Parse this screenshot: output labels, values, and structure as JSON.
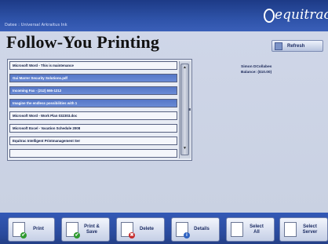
{
  "window": {
    "breadcrumb": "Datee : Universal Arkraitus Ink",
    "brand": "equitrac"
  },
  "page_title": "Follow-You Printing",
  "refresh": {
    "label": "Refresh",
    "icon": "refresh-icon"
  },
  "jobs": [
    {
      "name": "Microsoft Word - This is maintenance",
      "selected": false
    },
    {
      "name": "Gui Marrer Security Solutions.pdf",
      "selected": true
    },
    {
      "name": "Incoming Fax - (212) 555-1212",
      "selected": true
    },
    {
      "name": "Imagine the endless possibilities with 1",
      "selected": true
    },
    {
      "name": "Microsoft Word - Work Plan 032303.doc",
      "selected": false
    },
    {
      "name": "Microsoft Excel - Vacation Schedule 2008",
      "selected": false
    },
    {
      "name": "Equitrac Intelligent Printmanagement Ser",
      "selected": false
    },
    {
      "name": "",
      "selected": false
    }
  ],
  "user": {
    "line1": "Simon DCollabes",
    "line2": "Balance: ($10.00)"
  },
  "toolbar": {
    "buttons": [
      {
        "label_1": "Print",
        "label_2": "",
        "icon": "print-icon",
        "badge": "✔",
        "badge_color": "#2f9a2f"
      },
      {
        "label_1": "Print &",
        "label_2": "Save",
        "icon": "print-save-icon",
        "badge": "✔",
        "badge_color": "#2f9a2f"
      },
      {
        "label_1": "Delete",
        "label_2": "",
        "icon": "delete-icon",
        "badge": "✖",
        "badge_color": "#c62c2c"
      },
      {
        "label_1": "Details",
        "label_2": "",
        "icon": "details-icon",
        "badge": "i",
        "badge_color": "#2f63c2"
      },
      {
        "label_1": "Select",
        "label_2": "All",
        "icon": "select-all-icon",
        "badge": "",
        "badge_color": ""
      },
      {
        "label_1": "Select",
        "label_2": "Server",
        "icon": "select-server-icon",
        "badge": "",
        "badge_color": ""
      }
    ]
  }
}
